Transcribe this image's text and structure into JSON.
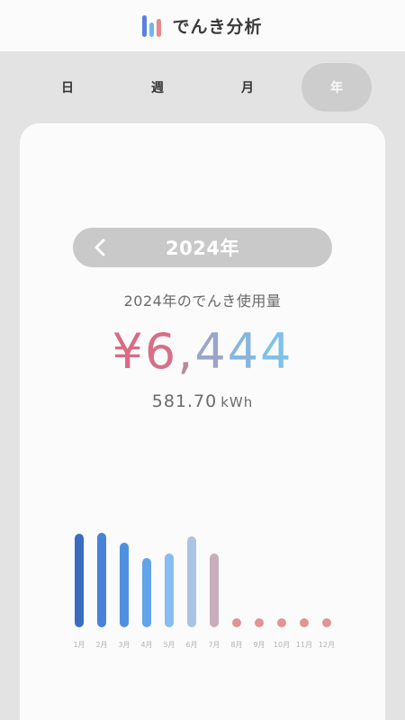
{
  "app": {
    "title": "でんき分析",
    "logo_icon": "bar-chart-logo-icon",
    "logo_colors": [
      "#5b7fe0",
      "#73b6e6",
      "#e68a8a"
    ]
  },
  "tabs": [
    {
      "label": "日",
      "active": false
    },
    {
      "label": "週",
      "active": false
    },
    {
      "label": "月",
      "active": false
    },
    {
      "label": "年",
      "active": true
    }
  ],
  "year_nav": {
    "prev_icon": "chevron-left-icon",
    "label": "2024年"
  },
  "usage": {
    "caption": "2024年のでんき使用量",
    "amount": "¥6,444",
    "amount_colors": [
      "#db6a84",
      "#d57088",
      "#b98aa0",
      "#9aa6c8",
      "#86b6de",
      "#7fc1e8"
    ],
    "kwh_value": "581.70",
    "kwh_unit": "kWh"
  },
  "chart_data": {
    "type": "bar",
    "categories": [
      "1月",
      "2月",
      "3月",
      "4月",
      "5月",
      "6月",
      "7月",
      "8月",
      "9月",
      "10月",
      "11月",
      "12月"
    ],
    "values": [
      100,
      101,
      90,
      74,
      79,
      97,
      79,
      0,
      0,
      0,
      0,
      0
    ],
    "colors": [
      "#3a6cc0",
      "#4982d8",
      "#4f8fe2",
      "#62a3ea",
      "#86bdee",
      "#a9c4e4",
      "#c8aeba",
      "#e09494",
      "#e09494",
      "#e09494",
      "#e09494",
      "#e09494"
    ],
    "ylim": [
      0,
      101
    ]
  }
}
